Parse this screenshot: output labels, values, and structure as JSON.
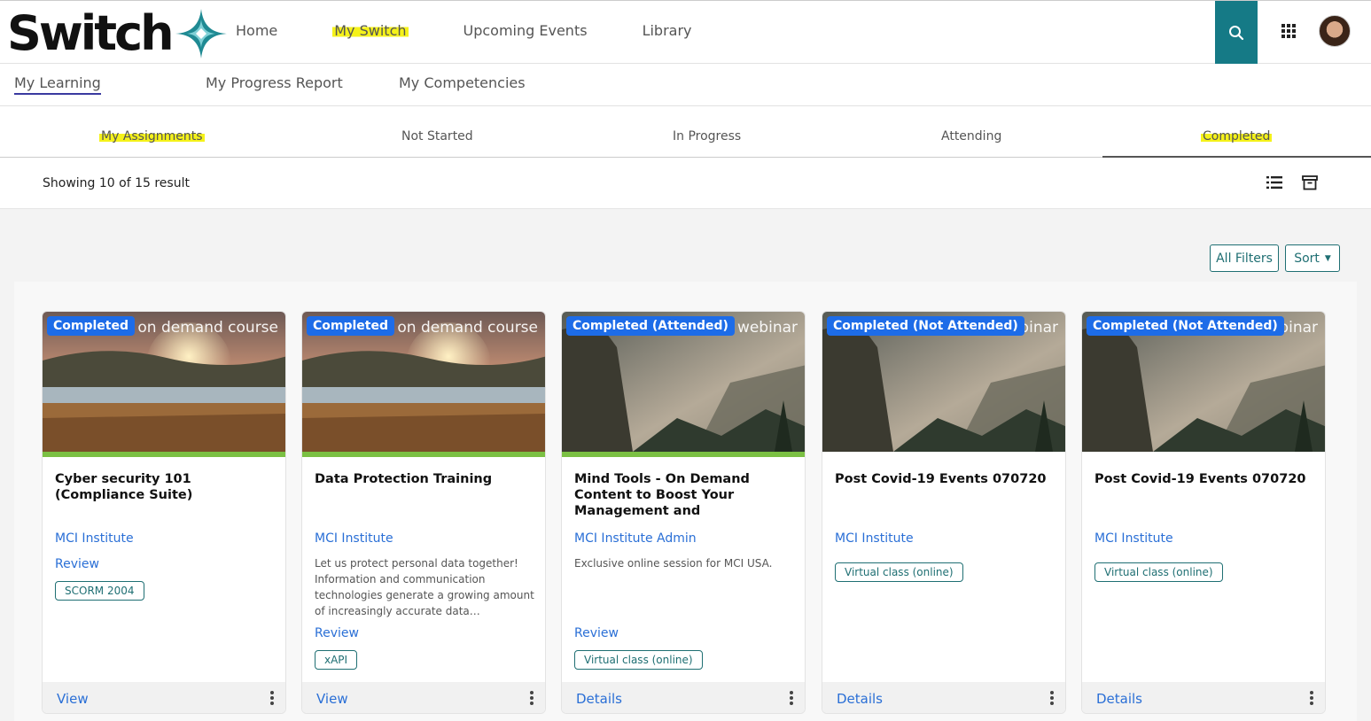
{
  "brand": {
    "name": "Switch"
  },
  "colors": {
    "teal": "#157a86",
    "accent_blue": "#1d6ce8",
    "link_blue": "#2a6fd6",
    "progress_green": "#7bc043",
    "highlight": "#f5f21a"
  },
  "mainnav": [
    {
      "label": "Home",
      "highlighted": false
    },
    {
      "label": "My Switch",
      "highlighted": true
    },
    {
      "label": "Upcoming Events",
      "highlighted": false
    },
    {
      "label": "Library",
      "highlighted": false
    }
  ],
  "subnav": [
    {
      "label": "My Learning",
      "active": true
    },
    {
      "label": "My Progress Report",
      "active": false
    },
    {
      "label": "My Competencies",
      "active": false
    }
  ],
  "tabs": [
    {
      "label": "My Assignments",
      "highlighted": true
    },
    {
      "label": "Not Started",
      "highlighted": false
    },
    {
      "label": "In Progress",
      "highlighted": false
    },
    {
      "label": "Attending",
      "highlighted": false
    },
    {
      "label": "Completed",
      "highlighted": true,
      "selected": true
    }
  ],
  "toolbar": {
    "result_text": "Showing 10 of 15 result"
  },
  "filters": {
    "all_filters_label": "All Filters",
    "sort_label": "Sort"
  },
  "cards": [
    {
      "status": "Completed",
      "type": "on demand course",
      "title": "Cyber security 101 (Compliance Suite)",
      "provider": "MCI Institute",
      "description": "",
      "review": "Review",
      "tag": "SCORM 2004",
      "action": "View",
      "progress_complete": true
    },
    {
      "status": "Completed",
      "type": "on demand course",
      "title": "Data Protection Training",
      "provider": "MCI Institute",
      "description": "Let us protect personal data together! Information and communication technologies generate a growing amount of increasingly accurate data…",
      "review": "Review",
      "tag": "xAPI",
      "action": "View",
      "progress_complete": true
    },
    {
      "status": "Completed (Attended)",
      "type": "webinar",
      "title": "Mind Tools - On Demand Content to Boost Your Management and Leadership…",
      "provider": "MCI Institute Admin",
      "description": "Exclusive online session for MCI USA.",
      "review": "Review",
      "tag": "Virtual class (online)",
      "action": "Details",
      "progress_complete": true
    },
    {
      "status": "Completed (Not Attended)",
      "type": "webinar",
      "title": "Post Covid-19 Events 070720",
      "provider": "MCI Institute",
      "description": "",
      "review": "",
      "tag": "Virtual class (online)",
      "action": "Details",
      "progress_complete": false
    },
    {
      "status": "Completed (Not Attended)",
      "type": "webinar",
      "title": "Post Covid-19 Events 070720",
      "provider": "MCI Institute",
      "description": "",
      "review": "",
      "tag": "Virtual class (online)",
      "action": "Details",
      "progress_complete": false
    }
  ]
}
